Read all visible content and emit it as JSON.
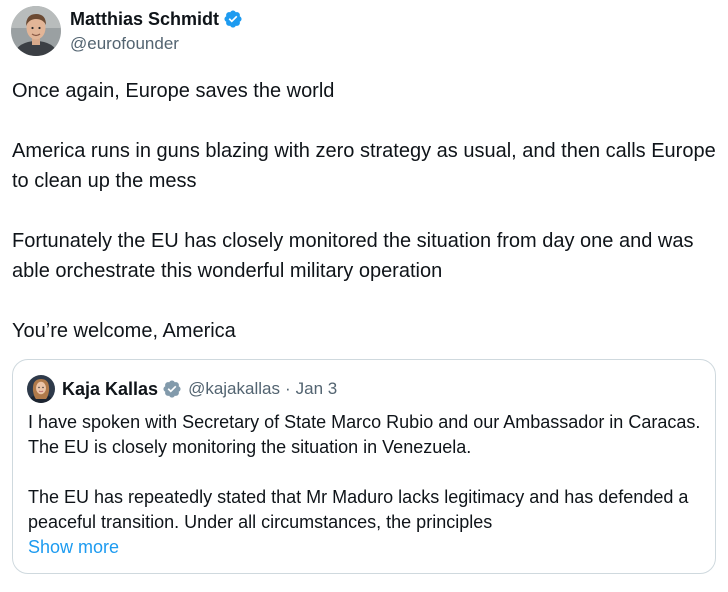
{
  "author": {
    "display_name": "Matthias Schmidt",
    "handle": "@eurofounder",
    "verified_icon": "verified-badge-icon",
    "verified_color": "#1d9bf0"
  },
  "tweet": {
    "paragraphs": [
      "Once again, Europe saves the world",
      "America runs in guns blazing with zero strategy as usual, and then calls Europe to clean up the mess",
      "Fortunately the EU has closely monitored the situation from day one and was able orchestrate this wonderful military operation",
      "You’re welcome, America"
    ]
  },
  "quoted_tweet": {
    "display_name": "Kaja Kallas",
    "handle": "@kajakallas",
    "separator": "·",
    "date": "Jan 3",
    "verified_icon": "verified-badge-gray-icon",
    "verified_color": "#829aab",
    "paragraphs": [
      "I have spoken with Secretary of State Marco Rubio and our Ambassador in Caracas. The EU is closely monitoring the situation in Venezuela.",
      "The EU has repeatedly stated that Mr Maduro lacks legitimacy and has defended a peaceful transition. Under all circumstances, the principles"
    ],
    "show_more_label": "Show more",
    "link_color": "#1d9bf0"
  }
}
